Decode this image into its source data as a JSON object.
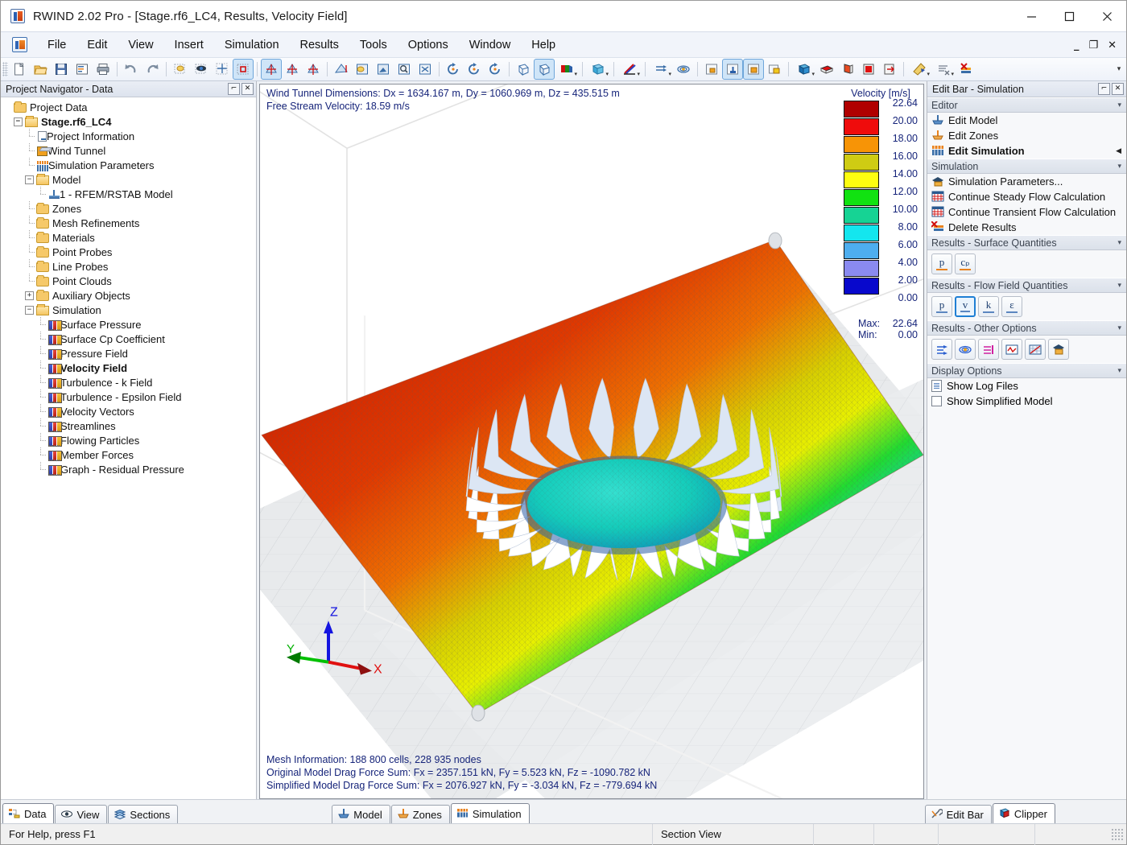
{
  "window": {
    "title": "RWIND 2.02 Pro - [Stage.rf6_LC4, Results, Velocity Field]",
    "app_icon": "rwind-logo-icon",
    "minimize": "minimize-icon",
    "maximize": "maximize-icon",
    "close": "close-icon"
  },
  "menu": {
    "items": [
      "File",
      "Edit",
      "View",
      "Insert",
      "Simulation",
      "Results",
      "Tools",
      "Options",
      "Window",
      "Help"
    ],
    "mdi": {
      "minimize": "_",
      "restore": "❐",
      "close": "✕"
    }
  },
  "toolbar": {
    "groups": [
      {
        "buttons": [
          {
            "name": "new-file-icon",
            "glyph": "new"
          },
          {
            "name": "open-file-icon",
            "glyph": "open"
          },
          {
            "name": "save-icon",
            "glyph": "save"
          },
          {
            "name": "printout-report-icon",
            "glyph": "report"
          },
          {
            "name": "print-icon",
            "glyph": "print"
          }
        ]
      },
      {
        "buttons": [
          {
            "name": "undo-icon",
            "glyph": "undo"
          },
          {
            "name": "redo-icon",
            "glyph": "redo"
          }
        ]
      },
      {
        "buttons": [
          {
            "name": "select-special-icon",
            "glyph": "selspecial"
          },
          {
            "name": "visibility-icon",
            "glyph": "eye"
          },
          {
            "name": "snap-grid-icon",
            "glyph": "snapgrid"
          },
          {
            "name": "select-rectangle-icon",
            "glyph": "selrect",
            "active": true
          }
        ]
      },
      {
        "buttons": [
          {
            "name": "view-isometric-icon",
            "glyph": "iso",
            "active": true
          },
          {
            "name": "view-front-icon",
            "glyph": "axes2"
          },
          {
            "name": "view-side-icon",
            "glyph": "axes3"
          }
        ]
      },
      {
        "buttons": [
          {
            "name": "zoom-window-icon",
            "glyph": "zoomwin"
          },
          {
            "name": "pan-icon",
            "glyph": "pan"
          },
          {
            "name": "zoom-previous-icon",
            "glyph": "zoomprev"
          },
          {
            "name": "zoom-magnifier-icon",
            "glyph": "magnifier"
          },
          {
            "name": "zoom-all-icon",
            "glyph": "zoomall"
          }
        ]
      },
      {
        "buttons": [
          {
            "name": "rotate-free-icon",
            "glyph": "rot1"
          },
          {
            "name": "rotate-ccw-icon",
            "glyph": "rot2"
          },
          {
            "name": "rotate-cw-icon",
            "glyph": "rot3"
          }
        ]
      },
      {
        "buttons": [
          {
            "name": "wireframe-view-icon",
            "glyph": "wire"
          },
          {
            "name": "solid-view-icon",
            "glyph": "solid",
            "active": true
          },
          {
            "name": "render-mode-icon",
            "glyph": "render",
            "caret": true
          }
        ]
      },
      {
        "buttons": [
          {
            "name": "wind-tunnel-box-icon",
            "glyph": "tunnel",
            "caret": true
          }
        ]
      },
      {
        "buttons": [
          {
            "name": "results-display-icon",
            "glyph": "resdisp",
            "caret": true
          }
        ]
      },
      {
        "buttons": [
          {
            "name": "flow-arrows-icon",
            "glyph": "flowarrow",
            "caret": true
          },
          {
            "name": "streamlines-icon",
            "glyph": "stream"
          }
        ]
      },
      {
        "buttons": [
          {
            "name": "show-model-icon",
            "glyph": "shmodel"
          },
          {
            "name": "show-zones-icon",
            "glyph": "shzones",
            "active": true
          },
          {
            "name": "show-simulation-icon",
            "glyph": "shsim",
            "active": true
          },
          {
            "name": "show-results-icon",
            "glyph": "shres"
          }
        ]
      },
      {
        "buttons": [
          {
            "name": "clipper-box-icon",
            "glyph": "clipbox",
            "caret": true
          },
          {
            "name": "section-plane-x-icon",
            "glyph": "secx"
          },
          {
            "name": "section-plane-y-icon",
            "glyph": "secy"
          },
          {
            "name": "section-plane-z-icon",
            "glyph": "secz"
          },
          {
            "name": "section-move-icon",
            "glyph": "secmove"
          }
        ]
      },
      {
        "buttons": [
          {
            "name": "measure-icon",
            "glyph": "measure",
            "caret": true
          },
          {
            "name": "cut-tool-icon",
            "glyph": "cut",
            "caret": true
          },
          {
            "name": "delete-results-icon",
            "glyph": "delres"
          }
        ]
      }
    ]
  },
  "navigator": {
    "caption": "Project Navigator - Data",
    "pin": "pin-icon",
    "close": "close-icon",
    "tree": [
      {
        "label": "Project Data",
        "indent": 0,
        "icon": "folder",
        "expander": "none"
      },
      {
        "label": "Stage.rf6_LC4",
        "indent": 1,
        "icon": "folder-open",
        "expander": "minus",
        "bold": true
      },
      {
        "label": "Project Information",
        "indent": 2,
        "icon": "doc",
        "expander": "line"
      },
      {
        "label": "Wind Tunnel",
        "indent": 2,
        "icon": "cube",
        "expander": "line"
      },
      {
        "label": "Simulation Parameters",
        "indent": 2,
        "icon": "sim",
        "expander": "line"
      },
      {
        "label": "Model",
        "indent": 2,
        "icon": "folder-open",
        "expander": "minus"
      },
      {
        "label": "1 - RFEM/RSTAB Model",
        "indent": 3,
        "icon": "model",
        "expander": "line"
      },
      {
        "label": "Zones",
        "indent": 2,
        "icon": "folder",
        "expander": "line"
      },
      {
        "label": "Mesh Refinements",
        "indent": 2,
        "icon": "folder",
        "expander": "line"
      },
      {
        "label": "Materials",
        "indent": 2,
        "icon": "folder",
        "expander": "line"
      },
      {
        "label": "Point Probes",
        "indent": 2,
        "icon": "folder",
        "expander": "line"
      },
      {
        "label": "Line Probes",
        "indent": 2,
        "icon": "folder",
        "expander": "line"
      },
      {
        "label": "Point Clouds",
        "indent": 2,
        "icon": "folder",
        "expander": "line"
      },
      {
        "label": "Auxiliary Objects",
        "indent": 2,
        "icon": "folder",
        "expander": "plus"
      },
      {
        "label": "Simulation",
        "indent": 2,
        "icon": "folder-open",
        "expander": "minus"
      },
      {
        "label": "Surface Pressure",
        "indent": 3,
        "icon": "result",
        "expander": "line"
      },
      {
        "label": "Surface Cp Coefficient",
        "indent": 3,
        "icon": "result",
        "expander": "line"
      },
      {
        "label": "Pressure Field",
        "indent": 3,
        "icon": "result",
        "expander": "line"
      },
      {
        "label": "Velocity Field",
        "indent": 3,
        "icon": "result",
        "expander": "line",
        "bold": true
      },
      {
        "label": "Turbulence - k Field",
        "indent": 3,
        "icon": "result",
        "expander": "line"
      },
      {
        "label": "Turbulence - Epsilon Field",
        "indent": 3,
        "icon": "result",
        "expander": "line"
      },
      {
        "label": "Velocity Vectors",
        "indent": 3,
        "icon": "result",
        "expander": "line"
      },
      {
        "label": "Streamlines",
        "indent": 3,
        "icon": "result",
        "expander": "line"
      },
      {
        "label": "Flowing Particles",
        "indent": 3,
        "icon": "result",
        "expander": "line"
      },
      {
        "label": "Member Forces",
        "indent": 3,
        "icon": "result",
        "expander": "line"
      },
      {
        "label": "Graph - Residual Pressure",
        "indent": 3,
        "icon": "result",
        "expander": "line"
      }
    ]
  },
  "viewport": {
    "info_top": [
      "Wind Tunnel Dimensions: Dx = 1634.167 m, Dy = 1060.969 m, Dz = 435.515 m",
      "Free Stream Velocity: 18.59 m/s"
    ],
    "info_bottom": [
      "Mesh Information: 188 800 cells, 228 935 nodes",
      "Original Model Drag Force Sum: Fx = 2357.151 kN, Fy = 5.523 kN, Fz = -1090.782 kN",
      "Simplified Model Drag Force Sum: Fx = 2076.927 kN, Fy = -3.034 kN, Fz = -779.694 kN"
    ],
    "axes": {
      "x": "X",
      "y": "Y",
      "z": "Z",
      "x_color": "#e01010",
      "y_color": "#00c000",
      "z_color": "#1010e0"
    }
  },
  "chart_data": {
    "type": "heatmap",
    "title": "Velocity [m/s]",
    "legend_position": "right",
    "min": 0.0,
    "max": 22.64,
    "max_label": "Max:",
    "min_label": "Min:",
    "max_value": "22.64",
    "min_value": "0.00",
    "tick_labels": [
      "22.64",
      "20.00",
      "18.00",
      "16.00",
      "14.00",
      "12.00",
      "10.00",
      "8.00",
      "6.00",
      "4.00",
      "2.00",
      "0.00"
    ],
    "band_colors": [
      "#b00000",
      "#ef0c0c",
      "#f79406",
      "#cfcc13",
      "#fdfd10",
      "#11e211",
      "#16d394",
      "#14e6ee",
      "#4eaeef",
      "#8a8af0",
      "#0808cc"
    ],
    "band_ranges": [
      [
        20.0,
        22.64
      ],
      [
        18.0,
        20.0
      ],
      [
        16.0,
        18.0
      ],
      [
        14.0,
        16.0
      ],
      [
        12.0,
        14.0
      ],
      [
        10.0,
        12.0
      ],
      [
        8.0,
        10.0
      ],
      [
        6.0,
        8.0
      ],
      [
        4.0,
        6.0
      ],
      [
        2.0,
        4.0
      ],
      [
        0.0,
        2.0
      ]
    ],
    "xlabel": "",
    "ylabel": ""
  },
  "editbar": {
    "caption": "Edit Bar - Simulation",
    "pin": "pin-icon",
    "close": "close-icon",
    "groups": [
      {
        "title": "Editor",
        "type": "list",
        "items": [
          {
            "label": "Edit Model",
            "icon": "model"
          },
          {
            "label": "Edit Zones",
            "icon": "zones"
          },
          {
            "label": "Edit Simulation",
            "icon": "sim",
            "bold": true,
            "arrow": true
          }
        ]
      },
      {
        "title": "Simulation",
        "type": "list",
        "items": [
          {
            "label": "Simulation Parameters...",
            "icon": "params"
          },
          {
            "label": "Continue Steady Flow Calculation",
            "icon": "calc"
          },
          {
            "label": "Continue Transient Flow Calculation",
            "icon": "calc"
          },
          {
            "label": "Delete Results",
            "icon": "delete"
          }
        ]
      },
      {
        "title": "Results - Surface Quantities",
        "type": "buttons",
        "buttons": [
          {
            "label": "p",
            "name": "surface-pressure-button",
            "underline": "#e8821e"
          },
          {
            "label": "cₚ",
            "name": "surface-cp-button",
            "underline": "#e8821e"
          }
        ]
      },
      {
        "title": "Results - Flow Field Quantities",
        "type": "buttons",
        "buttons": [
          {
            "label": "p",
            "name": "flow-pressure-button",
            "underline": "#5b86c0"
          },
          {
            "label": "v",
            "name": "flow-velocity-button",
            "underline": "#5b86c0",
            "selected": true
          },
          {
            "label": "k",
            "name": "flow-k-button",
            "underline": "#5b86c0"
          },
          {
            "label": "ε",
            "name": "flow-epsilon-button",
            "underline": "#5b86c0"
          }
        ]
      },
      {
        "title": "Results - Other Options",
        "type": "icons",
        "buttons": [
          {
            "name": "velocity-vectors-button",
            "glyph": "arrows"
          },
          {
            "name": "streamlines-button",
            "glyph": "stream"
          },
          {
            "name": "flowing-particles-button",
            "glyph": "particles"
          },
          {
            "name": "residual-graph-button",
            "glyph": "graph"
          },
          {
            "name": "chart-button",
            "glyph": "chart"
          },
          {
            "name": "result-colors-button",
            "glyph": "colors"
          }
        ]
      },
      {
        "title": "Display Options",
        "type": "checks",
        "items": [
          {
            "label": "Show Log Files",
            "control": "doc"
          },
          {
            "label": "Show Simplified Model",
            "control": "checkbox",
            "checked": false
          }
        ]
      }
    ]
  },
  "bottom_tabs": {
    "left": [
      {
        "label": "Data",
        "icon": "data-tree-icon",
        "active": true
      },
      {
        "label": "View",
        "icon": "eye-icon",
        "active": false
      },
      {
        "label": "Sections",
        "icon": "layers-icon",
        "active": false
      }
    ],
    "center": [
      {
        "label": "Model",
        "icon": "model-icon",
        "active": false
      },
      {
        "label": "Zones",
        "icon": "zones-icon",
        "active": false
      },
      {
        "label": "Simulation",
        "icon": "simulation-icon",
        "active": true
      }
    ],
    "right": [
      {
        "label": "Edit Bar",
        "icon": "tools-icon",
        "active": false
      },
      {
        "label": "Clipper",
        "icon": "clipper-icon",
        "active": true
      }
    ]
  },
  "statusbar": {
    "help": "For Help, press F1",
    "section_view": "Section View",
    "cells": [
      "",
      "",
      "",
      ""
    ]
  }
}
